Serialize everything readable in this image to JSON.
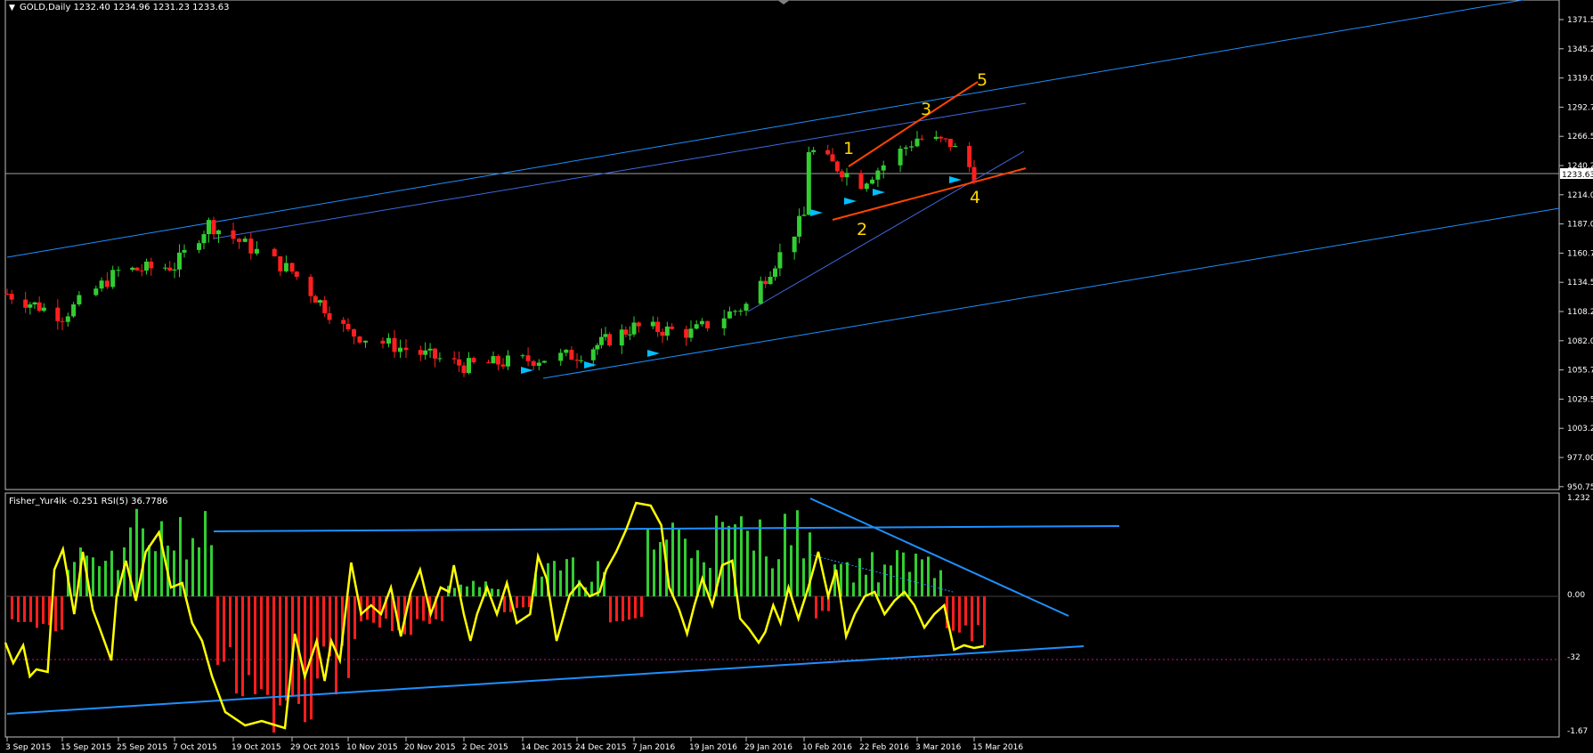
{
  "header": {
    "symbol": "GOLD,Daily",
    "ohlc": "1232.40 1234.96 1231.23 1233.63"
  },
  "indicator_header": {
    "name": "Fisher_Yur4ik -0.251",
    "rsi": "RSI(5) 36.7786"
  },
  "colors": {
    "background": "#000000",
    "bull": "#32cd32",
    "bear": "#ff1f1f",
    "channel": "#1e90ff",
    "wedge": "#ff4500",
    "wave_labels": "#ffd700",
    "arrows": "#00bfff",
    "rsi_line": "#ffff00",
    "grid_text": "#ffffff"
  },
  "price_axis": [
    "1371.50",
    "1345.25",
    "1319.00",
    "1292.75",
    "1266.50",
    "1240.25",
    "1214.00",
    "1187.00",
    "1160.75",
    "1134.50",
    "1108.25",
    "1082.00",
    "1055.75",
    "1029.50",
    "1003.25",
    "977.00",
    "950.75"
  ],
  "current_price": "1233.63",
  "indicator_axis": [
    "1.232",
    "0.00",
    "-32",
    "-1.67"
  ],
  "time_axis": [
    "3 Sep 2015",
    "15 Sep 2015",
    "25 Sep 2015",
    "7 Oct 2015",
    "19 Oct 2015",
    "29 Oct 2015",
    "10 Nov 2015",
    "20 Nov 2015",
    "2 Dec 2015",
    "14 Dec 2015",
    "24 Dec 2015",
    "7 Jan 2016",
    "19 Jan 2016",
    "29 Jan 2016",
    "10 Feb 2016",
    "22 Feb 2016",
    "3 Mar 2016",
    "15 Mar 2016"
  ],
  "wave_labels": [
    "1",
    "2",
    "3",
    "4",
    "5"
  ],
  "chart_data": [
    {
      "type": "candlestick",
      "title": "GOLD,Daily",
      "ylim": [
        950.75,
        1385
      ],
      "approx_close_path": [
        {
          "date": "3 Sep 2015",
          "close": 1125
        },
        {
          "date": "15 Sep 2015",
          "close": 1105
        },
        {
          "date": "25 Sep 2015",
          "close": 1145
        },
        {
          "date": "7 Oct 2015",
          "close": 1150
        },
        {
          "date": "14 Oct 2015",
          "close": 1188
        },
        {
          "date": "19 Oct 2015",
          "close": 1175
        },
        {
          "date": "29 Oct 2015",
          "close": 1145
        },
        {
          "date": "10 Nov 2015",
          "close": 1090
        },
        {
          "date": "20 Nov 2015",
          "close": 1075
        },
        {
          "date": "2 Dec 2015",
          "close": 1060
        },
        {
          "date": "14 Dec 2015",
          "close": 1065
        },
        {
          "date": "24 Dec 2015",
          "close": 1070
        },
        {
          "date": "7 Jan 2016",
          "close": 1095
        },
        {
          "date": "19 Jan 2016",
          "close": 1090
        },
        {
          "date": "29 Jan 2016",
          "close": 1115
        },
        {
          "date": "5 Feb 2016",
          "close": 1160
        },
        {
          "date": "10 Feb 2016",
          "close": 1195
        },
        {
          "date": "11 Feb 2016",
          "close": 1255
        },
        {
          "date": "22 Feb 2016",
          "close": 1225
        },
        {
          "date": "3 Mar 2016",
          "close": 1265
        },
        {
          "date": "10 Mar 2016",
          "close": 1260
        },
        {
          "date": "15 Mar 2016",
          "close": 1233.63
        }
      ]
    },
    {
      "type": "line",
      "title": "Fisher_Yur4ik -0.251 RSI(5) 36.7786",
      "ylim": [
        -1.67,
        1.232
      ],
      "reference_level": -32
    }
  ]
}
